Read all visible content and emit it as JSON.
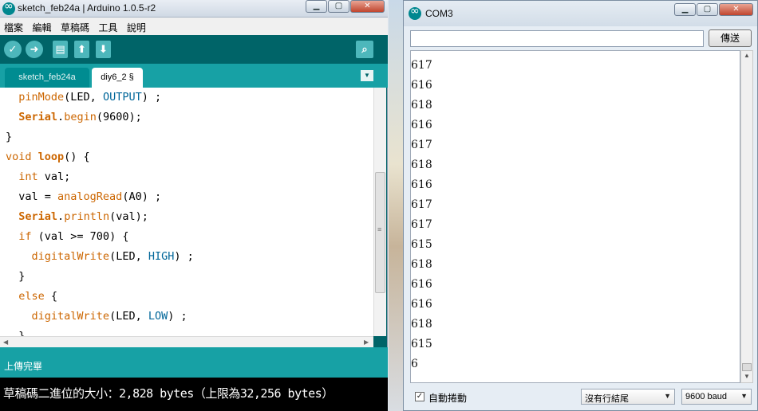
{
  "ide": {
    "title": "sketch_feb24a | Arduino 1.0.5-r2",
    "menu": [
      "檔案",
      "編輯",
      "草稿碼",
      "工具",
      "說明"
    ],
    "toolbar": {
      "verify_icon": "check-icon",
      "upload_icon": "arrow-right-icon",
      "new_icon": "document-icon",
      "open_icon": "arrow-up-icon",
      "save_icon": "arrow-down-icon",
      "serial_icon": "magnifier-icon"
    },
    "tabs": [
      {
        "label": "sketch_feb24a",
        "active": false
      },
      {
        "label": "diy6_2 §",
        "active": true
      }
    ],
    "code": [
      "  pinMode(LED, OUTPUT) ;",
      "  Serial.begin(9600);",
      "}",
      "void loop() {",
      "  int val;",
      "  val = analogRead(A0) ;",
      "  Serial.println(val);",
      "  if (val >= 700) {",
      "    digitalWrite(LED, HIGH) ;",
      "  }",
      "  else {",
      "    digitalWrite(LED, LOW) ;",
      "  }"
    ],
    "status": "上傳完畢",
    "console": "草稿碼二進位的大小：2,828 bytes（上限為32,256 bytes）",
    "colors": {
      "teal_dark": "#006468",
      "teal_light": "#17a1a5",
      "keyword": "#cc6600",
      "constant": "#006699"
    }
  },
  "serial": {
    "title": "COM3",
    "input_value": "",
    "send_label": "傳送",
    "output": [
      "617",
      "617",
      "616",
      "618",
      "616",
      "617",
      "618",
      "616",
      "617",
      "617",
      "615",
      "618",
      "616",
      "616",
      "618",
      "615",
      "6"
    ],
    "autoscroll_label": "自動捲動",
    "autoscroll_checked": true,
    "line_ending": "沒有行結尾",
    "baud": "9600 baud"
  }
}
